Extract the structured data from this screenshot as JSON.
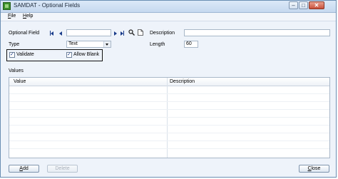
{
  "window": {
    "title": "SAMDAT - Optional Fields"
  },
  "menu": [
    {
      "accel": "F",
      "rest": "ile"
    },
    {
      "accel": "H",
      "rest": "elp"
    }
  ],
  "form": {
    "optional_field_label": "Optional Field",
    "optional_field_value": "",
    "description_label": "Description",
    "description_value": "",
    "type_label": "Type",
    "type_value": "Text",
    "length_label": "Length",
    "length_value": "60",
    "validate_label": "Validate",
    "validate_checked": true,
    "allow_blank_label": "Allow Blank",
    "allow_blank_checked": true
  },
  "values": {
    "group_label": "Values",
    "columns": [
      "Value",
      "Description"
    ]
  },
  "buttons": {
    "add": {
      "accel": "A",
      "rest": "dd"
    },
    "delete": {
      "text": "Delete"
    },
    "close": {
      "accel": "C",
      "rest": "lose"
    }
  },
  "icons": [
    "app-icon",
    "first-record-icon",
    "previous-record-icon",
    "next-record-icon",
    "last-record-icon",
    "finder-icon",
    "new-document-icon",
    "minimize-icon",
    "maximize-icon",
    "close-icon"
  ]
}
